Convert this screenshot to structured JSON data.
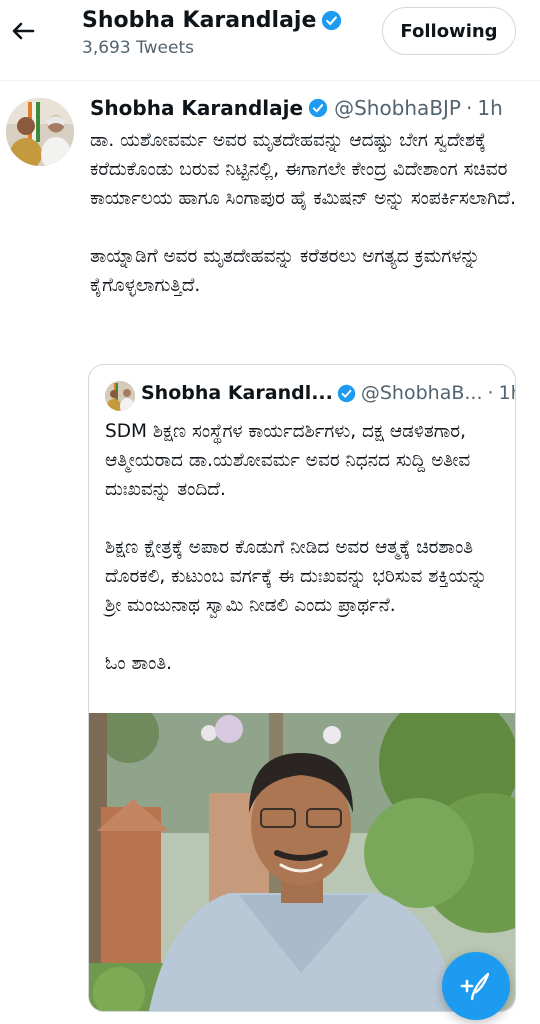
{
  "header": {
    "name": "Shobha Karandlaje",
    "tweet_count": "3,693 Tweets",
    "following_label": "Following"
  },
  "tweet": {
    "name": "Shobha Karandlaje",
    "handle": "@ShobhaBJP",
    "separator": "·",
    "time": "1h",
    "text": "ಡಾ. ಯಶೋವರ್ಮ ಅವರ ಮೃತದೇಹವನ್ನು ಆದಷ್ಟು ಬೇಗ ಸ್ವದೇಶಕ್ಕೆ ಕರೆದುಕೊಂಡು ಬರುವ ನಿಟ್ಟಿನಲ್ಲಿ, ಈಗಾಗಲೇ ಕೇಂದ್ರ ವಿದೇಶಾಂಗ ಸಚಿವರ ಕಾರ್ಯಾಲಯ ಹಾಗೂ ಸಿಂಗಾಪುರ ಹೈ ಕಮಿಷನ್ ಅನ್ನು ಸಂಪರ್ಕಿಸಲಾಗಿದೆ.\n\nತಾಯ್ನಾಡಿಗೆ ಅವರ ಮೃತದೇಹವನ್ನು ಕರೆತರಲು ಅಗತ್ಯದ ಕ್ರಮಗಳನ್ನು ಕೈಗೊಳ್ಳಲಾಗುತ್ತಿದೆ."
  },
  "quote": {
    "name": "Shobha Karandl...",
    "handle": "@ShobhaB...",
    "separator": "·",
    "time": "1h",
    "text": "SDM ಶಿಕ್ಷಣ ಸಂಸ್ಥೆಗಳ ಕಾರ್ಯದರ್ಶಿಗಳು, ದಕ್ಷ ಆಡಳಿತಗಾರ, ಆತ್ಮೀಯರಾದ ಡಾ.ಯಶೋವರ್ಮ ಅವರ ನಿಧನದ ಸುದ್ದಿ ಅತೀವ ದುಃಖವನ್ನು ತಂದಿದೆ.\n\nಶಿಕ್ಷಣ ಕ್ಷೇತ್ರಕ್ಕೆ ಅಪಾರ ಕೊಡುಗೆ ನೀಡಿದ ಅವರ ಆತ್ಮಕ್ಕೆ ಚಿರಶಾಂತಿ ದೊರಕಲಿ, ಕುಟುಂಬ ವರ್ಗಕ್ಕೆ ಈ ದುಃಖವನ್ನು ಭರಿಸುವ ಶಕ್ತಿಯನ್ನು ಶ್ರೀ ಮಂಜುನಾಥ ಸ್ವಾಮಿ ನೀಡಲಿ ಎಂದು ಪ್ರಾರ್ಥನೆ.\n\nಓಂ ಶಾಂತಿ."
  },
  "colors": {
    "accent": "#1d9bf0",
    "text_primary": "#0f1419",
    "text_secondary": "#536471",
    "border": "#cfd9de"
  },
  "icons": {
    "back": "arrow-left-icon",
    "verified": "verified-badge-icon",
    "compose": "compose-tweet-icon"
  }
}
